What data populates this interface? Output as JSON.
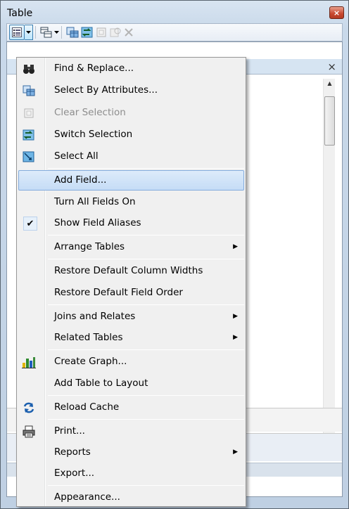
{
  "window": {
    "title": "Table",
    "close_symbol": "×"
  },
  "table": {
    "close_symbol": "×"
  },
  "menu": {
    "items": [
      {
        "label": "Find & Replace...",
        "icon": "binoculars-icon",
        "disabled": false
      },
      {
        "label": "Select By Attributes...",
        "icon": "select-by-attributes-icon",
        "disabled": false
      },
      {
        "label": "Clear Selection",
        "icon": "clear-selection-icon",
        "disabled": true
      },
      {
        "label": "Switch Selection",
        "icon": "switch-selection-icon",
        "disabled": false
      },
      {
        "label": "Select All",
        "icon": "select-all-icon",
        "disabled": false
      },
      {
        "label": "Add Field...",
        "icon": "",
        "disabled": false,
        "highlighted": true
      },
      {
        "label": "Turn All Fields On",
        "icon": "",
        "disabled": false
      },
      {
        "label": "Show Field Aliases",
        "icon": "checkmark-icon",
        "checked": true
      },
      {
        "label": "Arrange Tables",
        "icon": "",
        "submenu": true
      },
      {
        "label": "Restore Default Column Widths",
        "icon": ""
      },
      {
        "label": "Restore Default Field Order",
        "icon": ""
      },
      {
        "label": "Joins and Relates",
        "icon": "",
        "submenu": true
      },
      {
        "label": "Related Tables",
        "icon": "",
        "submenu": true
      },
      {
        "label": "Create Graph...",
        "icon": "bar-graph-icon"
      },
      {
        "label": "Add Table to Layout",
        "icon": ""
      },
      {
        "label": "Reload Cache",
        "icon": "reload-icon"
      },
      {
        "label": "Print...",
        "icon": "printer-icon"
      },
      {
        "label": "Reports",
        "icon": "",
        "submenu": true
      },
      {
        "label": "Export...",
        "icon": ""
      },
      {
        "label": "Appearance...",
        "icon": ""
      }
    ],
    "submenu_arrow": "▶",
    "check_symbol": "✔"
  },
  "colors": {
    "highlight_border": "#84acdd",
    "close_button": "#c8472e"
  }
}
